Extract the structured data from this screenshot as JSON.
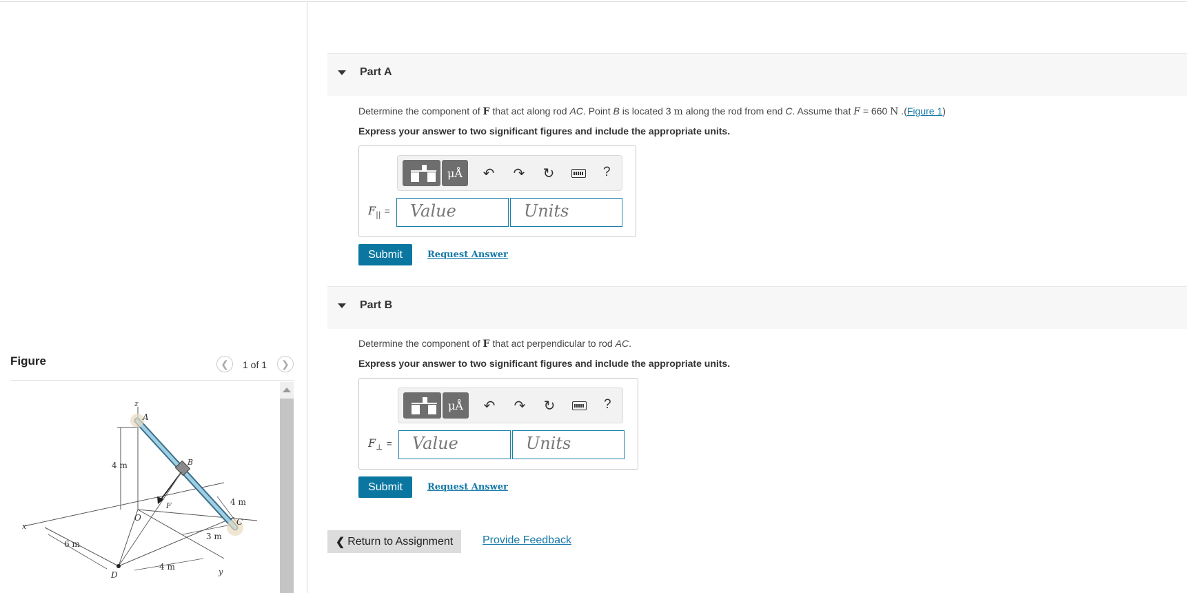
{
  "figure_panel": {
    "title": "Figure",
    "pager": "1 of 1",
    "prev_icon": "chevron-left-icon",
    "next_icon": "chevron-right-icon",
    "labels": {
      "z": "z",
      "A": "A",
      "B": "B",
      "O": "O",
      "F": "F",
      "C": "C",
      "D": "D",
      "x": "x",
      "y": "y",
      "dim_4m_vertical": "4 m",
      "dim_4m_right": "4 m",
      "dim_3m": "3 m",
      "dim_6m": "6 m",
      "dim_4m_bottom": "4 m"
    }
  },
  "part_a": {
    "title": "Part A",
    "prompt": {
      "t1": "Determine the component of ",
      "F_bold": "F",
      "t2": " that act along rod ",
      "AC": "AC",
      "t3": ". Point ",
      "B": "B",
      "t4": " is located 3 ",
      "m": "m",
      "t5": " along the rod from end ",
      "C": "C",
      "t6": ". Assume that ",
      "F_it": "F",
      "t7": " = 660 ",
      "N": "N",
      "t8": " .(",
      "link": "Figure 1",
      "t9": ")"
    },
    "instruction": "Express your answer to two significant figures and include the appropriate units.",
    "var_label": "F",
    "var_sub": "||",
    "equals": "=",
    "value_placeholder": "Value",
    "units_placeholder": "Units",
    "submit": "Submit",
    "request": "Request Answer"
  },
  "part_b": {
    "title": "Part B",
    "prompt": {
      "t1": "Determine the component of ",
      "F_bold": "F",
      "t2": " that act perpendicular to rod ",
      "AC": "AC",
      "t3": "."
    },
    "instruction": "Express your answer to two significant figures and include the appropriate units.",
    "var_label": "F",
    "var_sub": "⊥",
    "equals": "=",
    "value_placeholder": "Value",
    "units_placeholder": "Units",
    "submit": "Submit",
    "request": "Request Answer"
  },
  "toolbar": {
    "units_button": "μÅ",
    "help": "?",
    "icons": [
      "templates-icon",
      "units-icon",
      "undo-icon",
      "redo-icon",
      "reset-icon",
      "keyboard-icon",
      "help-icon"
    ]
  },
  "footer": {
    "return": "Return to Assignment",
    "feedback": "Provide Feedback"
  }
}
